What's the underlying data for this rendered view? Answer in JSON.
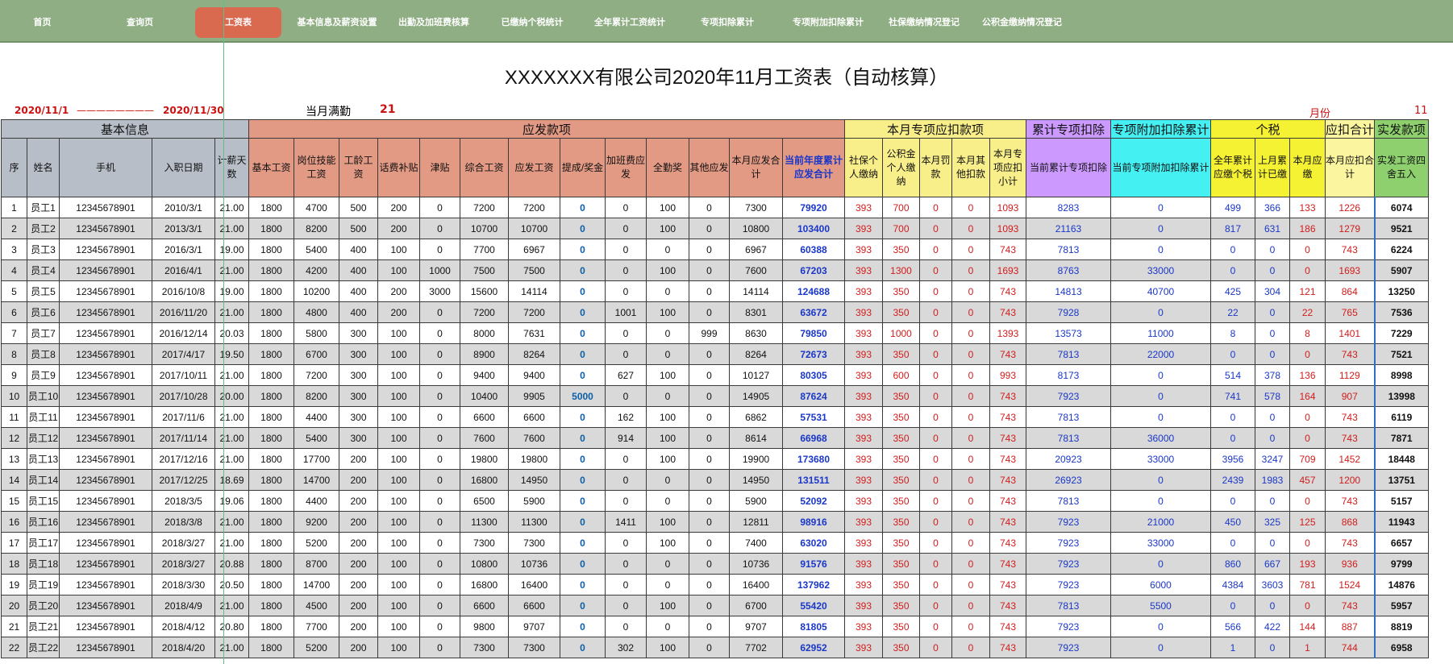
{
  "nav": [
    {
      "label": "首页",
      "active": false
    },
    {
      "label": "查询页",
      "active": false
    },
    {
      "label": "工资表",
      "active": true
    },
    {
      "label": "基本信息及薪资设置",
      "active": false
    },
    {
      "label": "出勤及加班费核算",
      "active": false
    },
    {
      "label": "已缴纳个税统计",
      "active": false
    },
    {
      "label": "全年累计工资统计",
      "active": false
    },
    {
      "label": "专项扣除累计",
      "active": false
    },
    {
      "label": "专项附加扣除累计",
      "active": false
    },
    {
      "label": "社保缴纳情况登记",
      "active": false
    },
    {
      "label": "公积金缴纳情况登记",
      "active": false
    }
  ],
  "title": "XXXXXXX有限公司2020年11月工资表（自动核算）",
  "period": {
    "start": "2020/11/1",
    "dash": "————————",
    "end": "2020/11/30"
  },
  "full_attendance": {
    "label": "当月满勤",
    "value": "21"
  },
  "month": {
    "label": "月份",
    "value": "11"
  },
  "groups": [
    "基本信息",
    "应发款项",
    "本月专项应扣款项",
    "累计专项扣除",
    "专项附加扣除累计",
    "个税",
    "应扣合计",
    "实发款项"
  ],
  "headers": [
    "序",
    "姓名",
    "手机",
    "入职日期",
    "计薪天数",
    "基本工资",
    "岗位技能工资",
    "工龄工资",
    "话费补贴",
    "津贴",
    "综合工资",
    "应发工资",
    "提成/奖金",
    "加班费应发",
    "全勤奖",
    "其他应发",
    "本月应发合计",
    "当前年度累计应发合计",
    "社保个人缴纳",
    "公积金个人缴纳",
    "本月罚款",
    "本月其他扣款",
    "本月专项应扣小计",
    "当前累计专项扣除",
    "当前专项附加扣除累计",
    "全年累计应缴个税",
    "上月累计已缴",
    "本月应缴",
    "本月应扣合计",
    "实发工资四舍五入"
  ],
  "rows": [
    [
      "1",
      "员工1",
      "12345678901",
      "2010/3/1",
      "21.00",
      "1800",
      "4700",
      "500",
      "200",
      "0",
      "7200",
      "7200",
      "0",
      "0",
      "100",
      "0",
      "7300",
      "79920",
      "393",
      "700",
      "0",
      "0",
      "1093",
      "8283",
      "0",
      "499",
      "366",
      "133",
      "1226",
      "6074"
    ],
    [
      "2",
      "员工2",
      "12345678901",
      "2013/3/1",
      "21.00",
      "1800",
      "8200",
      "500",
      "200",
      "0",
      "10700",
      "10700",
      "0",
      "0",
      "100",
      "0",
      "10800",
      "103400",
      "393",
      "700",
      "0",
      "0",
      "1093",
      "21163",
      "0",
      "817",
      "631",
      "186",
      "1279",
      "9521"
    ],
    [
      "3",
      "员工3",
      "12345678901",
      "2016/3/1",
      "19.00",
      "1800",
      "5400",
      "400",
      "100",
      "0",
      "7700",
      "6967",
      "0",
      "0",
      "0",
      "0",
      "6967",
      "60388",
      "393",
      "350",
      "0",
      "0",
      "743",
      "7813",
      "0",
      "0",
      "0",
      "0",
      "743",
      "6224"
    ],
    [
      "4",
      "员工4",
      "12345678901",
      "2016/4/1",
      "21.00",
      "1800",
      "4200",
      "400",
      "100",
      "1000",
      "7500",
      "7500",
      "0",
      "0",
      "100",
      "0",
      "7600",
      "67203",
      "393",
      "1300",
      "0",
      "0",
      "1693",
      "8763",
      "33000",
      "0",
      "0",
      "0",
      "1693",
      "5907"
    ],
    [
      "5",
      "员工5",
      "12345678901",
      "2016/10/8",
      "19.00",
      "1800",
      "10200",
      "400",
      "200",
      "3000",
      "15600",
      "14114",
      "0",
      "0",
      "0",
      "0",
      "14114",
      "124688",
      "393",
      "350",
      "0",
      "0",
      "743",
      "14813",
      "40700",
      "425",
      "304",
      "121",
      "864",
      "13250"
    ],
    [
      "6",
      "员工6",
      "12345678901",
      "2016/11/20",
      "21.00",
      "1800",
      "4800",
      "400",
      "200",
      "0",
      "7200",
      "7200",
      "0",
      "1001",
      "100",
      "0",
      "8301",
      "63672",
      "393",
      "350",
      "0",
      "0",
      "743",
      "7928",
      "0",
      "22",
      "0",
      "22",
      "765",
      "7536"
    ],
    [
      "7",
      "员工7",
      "12345678901",
      "2016/12/14",
      "20.03",
      "1800",
      "5800",
      "300",
      "100",
      "0",
      "8000",
      "7631",
      "0",
      "0",
      "0",
      "999",
      "8630",
      "79850",
      "393",
      "1000",
      "0",
      "0",
      "1393",
      "13573",
      "11000",
      "8",
      "0",
      "8",
      "1401",
      "7229"
    ],
    [
      "8",
      "员工8",
      "12345678901",
      "2017/4/17",
      "19.50",
      "1800",
      "6700",
      "300",
      "100",
      "0",
      "8900",
      "8264",
      "0",
      "0",
      "0",
      "0",
      "8264",
      "72673",
      "393",
      "350",
      "0",
      "0",
      "743",
      "7813",
      "22000",
      "0",
      "0",
      "0",
      "743",
      "7521"
    ],
    [
      "9",
      "员工9",
      "12345678901",
      "2017/10/11",
      "21.00",
      "1800",
      "7200",
      "300",
      "100",
      "0",
      "9400",
      "9400",
      "0",
      "627",
      "100",
      "0",
      "10127",
      "80305",
      "393",
      "600",
      "0",
      "0",
      "993",
      "8173",
      "0",
      "514",
      "378",
      "136",
      "1129",
      "8998"
    ],
    [
      "10",
      "员工10",
      "12345678901",
      "2017/10/28",
      "20.00",
      "1800",
      "8200",
      "300",
      "100",
      "0",
      "10400",
      "9905",
      "5000",
      "0",
      "0",
      "0",
      "14905",
      "87624",
      "393",
      "350",
      "0",
      "0",
      "743",
      "7923",
      "0",
      "741",
      "578",
      "164",
      "907",
      "13998"
    ],
    [
      "11",
      "员工11",
      "12345678901",
      "2017/11/6",
      "21.00",
      "1800",
      "4400",
      "300",
      "100",
      "0",
      "6600",
      "6600",
      "0",
      "162",
      "100",
      "0",
      "6862",
      "57531",
      "393",
      "350",
      "0",
      "0",
      "743",
      "7813",
      "0",
      "0",
      "0",
      "0",
      "743",
      "6119"
    ],
    [
      "12",
      "员工12",
      "12345678901",
      "2017/11/14",
      "21.00",
      "1800",
      "5400",
      "300",
      "100",
      "0",
      "7600",
      "7600",
      "0",
      "914",
      "100",
      "0",
      "8614",
      "66968",
      "393",
      "350",
      "0",
      "0",
      "743",
      "7813",
      "36000",
      "0",
      "0",
      "0",
      "743",
      "7871"
    ],
    [
      "13",
      "员工13",
      "12345678901",
      "2017/12/16",
      "21.00",
      "1800",
      "17700",
      "200",
      "100",
      "0",
      "19800",
      "19800",
      "0",
      "0",
      "100",
      "0",
      "19900",
      "173680",
      "393",
      "350",
      "0",
      "0",
      "743",
      "20923",
      "33000",
      "3956",
      "3247",
      "709",
      "1452",
      "18448"
    ],
    [
      "14",
      "员工14",
      "12345678901",
      "2017/12/25",
      "18.69",
      "1800",
      "14700",
      "200",
      "100",
      "0",
      "16800",
      "14950",
      "0",
      "0",
      "0",
      "0",
      "14950",
      "131511",
      "393",
      "350",
      "0",
      "0",
      "743",
      "26923",
      "0",
      "2439",
      "1983",
      "457",
      "1200",
      "13751"
    ],
    [
      "15",
      "员工15",
      "12345678901",
      "2018/3/5",
      "19.06",
      "1800",
      "4400",
      "200",
      "100",
      "0",
      "6500",
      "5900",
      "0",
      "0",
      "0",
      "0",
      "5900",
      "52092",
      "393",
      "350",
      "0",
      "0",
      "743",
      "7813",
      "0",
      "0",
      "0",
      "0",
      "743",
      "5157"
    ],
    [
      "16",
      "员工16",
      "12345678901",
      "2018/3/8",
      "21.00",
      "1800",
      "9200",
      "200",
      "100",
      "0",
      "11300",
      "11300",
      "0",
      "1411",
      "100",
      "0",
      "12811",
      "98916",
      "393",
      "350",
      "0",
      "0",
      "743",
      "7923",
      "21000",
      "450",
      "325",
      "125",
      "868",
      "11943"
    ],
    [
      "17",
      "员工17",
      "12345678901",
      "2018/3/27",
      "21.00",
      "1800",
      "5200",
      "200",
      "100",
      "0",
      "7300",
      "7300",
      "0",
      "0",
      "100",
      "0",
      "7400",
      "63020",
      "393",
      "350",
      "0",
      "0",
      "743",
      "7923",
      "33000",
      "0",
      "0",
      "0",
      "743",
      "6657"
    ],
    [
      "18",
      "员工18",
      "12345678901",
      "2018/3/27",
      "20.88",
      "1800",
      "8700",
      "200",
      "100",
      "0",
      "10800",
      "10736",
      "0",
      "0",
      "0",
      "0",
      "10736",
      "91576",
      "393",
      "350",
      "0",
      "0",
      "743",
      "7923",
      "0",
      "860",
      "667",
      "193",
      "936",
      "9799"
    ],
    [
      "19",
      "员工19",
      "12345678901",
      "2018/3/30",
      "20.50",
      "1800",
      "14700",
      "200",
      "100",
      "0",
      "16800",
      "16400",
      "0",
      "0",
      "0",
      "0",
      "16400",
      "137962",
      "393",
      "350",
      "0",
      "0",
      "743",
      "7923",
      "6000",
      "4384",
      "3603",
      "781",
      "1524",
      "14876"
    ],
    [
      "20",
      "员工20",
      "12345678901",
      "2018/4/9",
      "21.00",
      "1800",
      "4500",
      "200",
      "100",
      "0",
      "6600",
      "6600",
      "0",
      "0",
      "100",
      "0",
      "6700",
      "55420",
      "393",
      "350",
      "0",
      "0",
      "743",
      "7813",
      "5500",
      "0",
      "0",
      "0",
      "743",
      "5957"
    ],
    [
      "21",
      "员工21",
      "12345678901",
      "2018/4/12",
      "20.80",
      "1800",
      "7700",
      "200",
      "100",
      "0",
      "9800",
      "9707",
      "0",
      "0",
      "0",
      "0",
      "9707",
      "81805",
      "393",
      "350",
      "0",
      "0",
      "743",
      "7923",
      "0",
      "566",
      "422",
      "144",
      "887",
      "8819"
    ],
    [
      "22",
      "员工22",
      "12345678901",
      "2018/4/20",
      "21.00",
      "1800",
      "5200",
      "200",
      "100",
      "0",
      "7300",
      "7300",
      "0",
      "302",
      "100",
      "0",
      "7702",
      "62952",
      "393",
      "350",
      "0",
      "0",
      "743",
      "7923",
      "0",
      "1",
      "0",
      "1",
      "744",
      "6958"
    ]
  ]
}
